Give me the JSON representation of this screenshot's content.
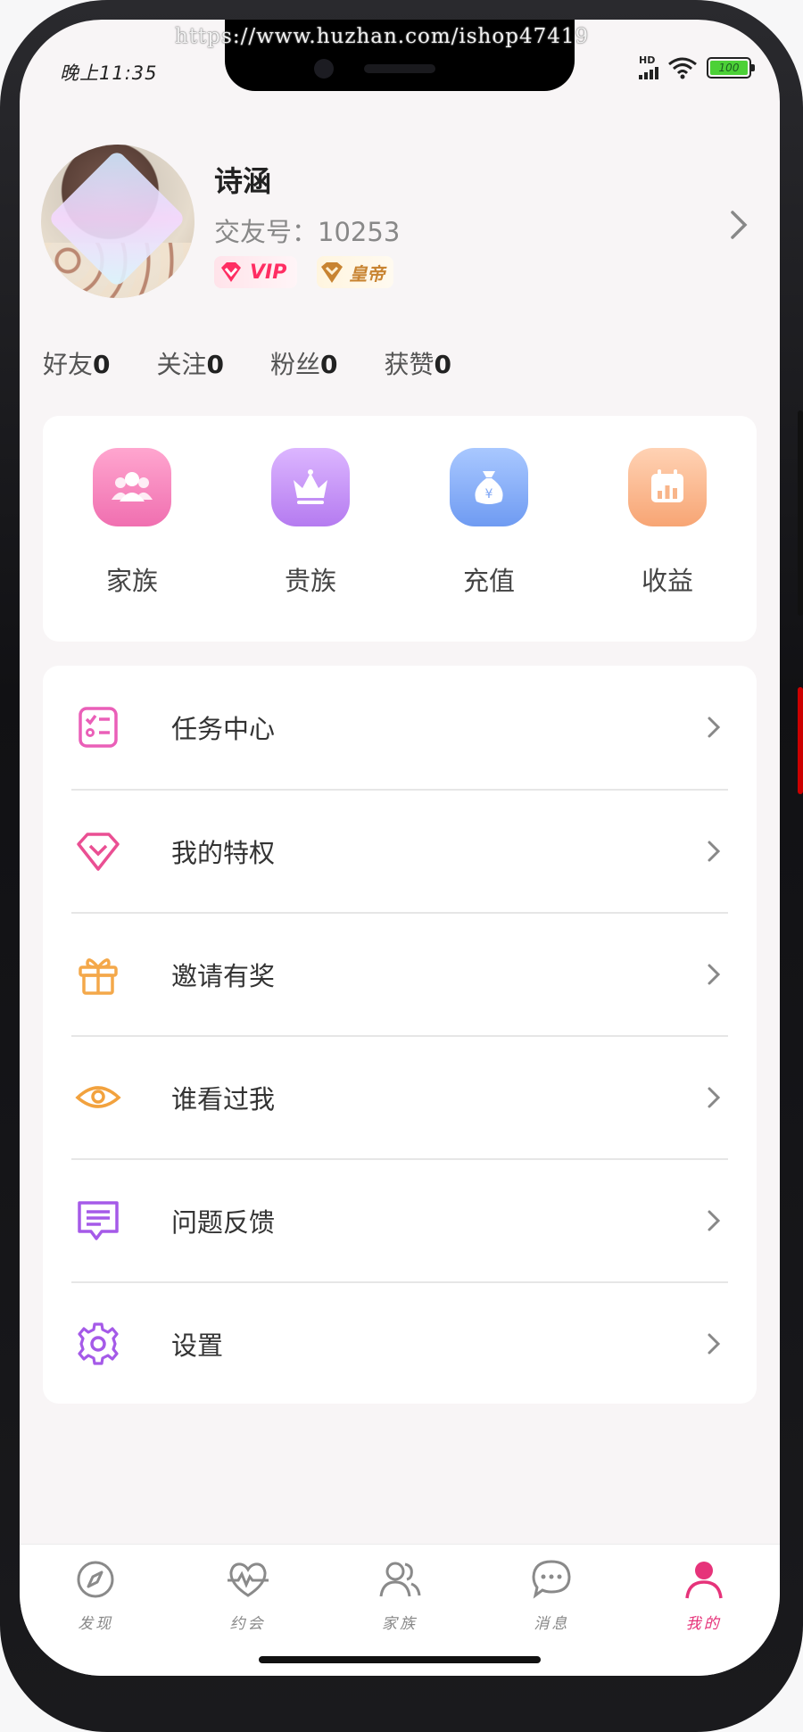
{
  "status_bar": {
    "time": "晚上11:35",
    "network": "HD",
    "battery": "100"
  },
  "watermark": "https://www.huzhan.com/ishop47419",
  "profile": {
    "name": "诗涵",
    "uid_label": "交友号：",
    "uid_value": "10253",
    "badge_vip": "VIP",
    "badge_emperor": "皇帝"
  },
  "stats": [
    {
      "label": "好友",
      "value": "0"
    },
    {
      "label": "关注",
      "value": "0"
    },
    {
      "label": "粉丝",
      "value": "0"
    },
    {
      "label": "获赞",
      "value": "0"
    }
  ],
  "quick_actions": [
    {
      "label": "家族",
      "icon": "family-icon",
      "color_from": "#ffa6cf",
      "color_to": "#f06fb0"
    },
    {
      "label": "贵族",
      "icon": "crown-icon",
      "color_from": "#dcb6ff",
      "color_to": "#b57bf0"
    },
    {
      "label": "充值",
      "icon": "money-bag-icon",
      "color_from": "#a9c8ff",
      "color_to": "#6f9bf2"
    },
    {
      "label": "收益",
      "icon": "calendar-chart-icon",
      "color_from": "#ffd2b4",
      "color_to": "#f7a574"
    }
  ],
  "menu": [
    {
      "label": "任务中心",
      "icon": "task-list-icon",
      "color": "#ea5fb8"
    },
    {
      "label": "我的特权",
      "icon": "diamond-icon",
      "color": "#ea4f93"
    },
    {
      "label": "邀请有奖",
      "icon": "gift-icon",
      "color": "#f4a84a"
    },
    {
      "label": "谁看过我",
      "icon": "eye-icon",
      "color": "#f2a23e"
    },
    {
      "label": "问题反馈",
      "icon": "feedback-icon",
      "color": "#a55ae8"
    },
    {
      "label": "设置",
      "icon": "gear-icon",
      "color": "#a55ae8"
    }
  ],
  "tabs": [
    {
      "label": "发现",
      "icon": "compass-icon",
      "active": false
    },
    {
      "label": "约会",
      "icon": "heart-pulse-icon",
      "active": false
    },
    {
      "label": "家族",
      "icon": "people-icon",
      "active": false
    },
    {
      "label": "消息",
      "icon": "chat-bubble-icon",
      "active": false
    },
    {
      "label": "我的",
      "icon": "user-icon",
      "active": true
    }
  ],
  "colors": {
    "accent": "#e6337a",
    "text_primary": "#222222",
    "text_secondary": "#888888",
    "background": "#f8f5f6"
  }
}
